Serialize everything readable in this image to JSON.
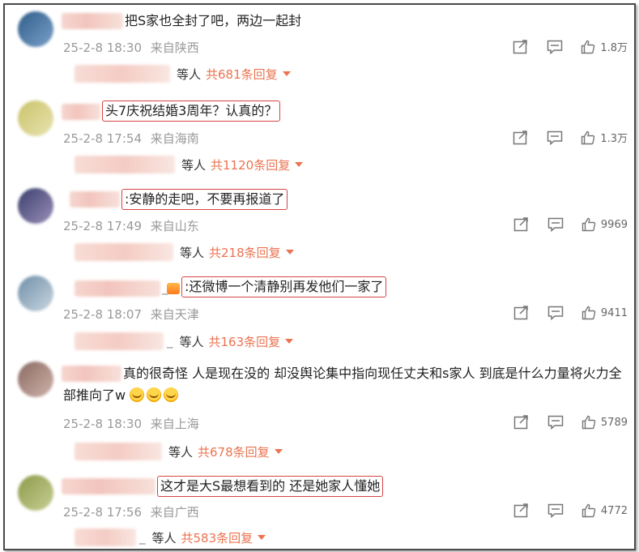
{
  "comments": [
    {
      "text": "把S家也全封了吧，两边一起封",
      "boxed": false,
      "date": "25-2-8 18:30",
      "location": "来自陕西",
      "likes": "1.8万",
      "reply_label": "等人",
      "reply_count": "共681条回复",
      "avatar_colors": [
        "#2f5d8a",
        "#7aa0c8"
      ]
    },
    {
      "text": "头7庆祝结婚3周年？认真的？",
      "boxed": true,
      "date": "25-2-8 17:54",
      "location": "来自海南",
      "likes": "1.3万",
      "reply_label": "等人",
      "reply_count": "共1120条回复",
      "avatar_colors": [
        "#c9c36a",
        "#e8e3b0"
      ]
    },
    {
      "text": ":安静的走吧，不要再报道了",
      "boxed": true,
      "date": "25-2-8 17:49",
      "location": "来自山东",
      "likes": "9969",
      "reply_label": "等人",
      "reply_count": "共218条回复",
      "avatar_colors": [
        "#3a3f6e",
        "#9a8fb8"
      ]
    },
    {
      "text": ":还微博一个清静别再发他们一家了",
      "boxed": true,
      "date": "25-2-8 18:07",
      "location": "来自天津",
      "likes": "9411",
      "reply_label": "等人",
      "reply_count": "共163条回复",
      "avatar_colors": [
        "#6f8fa8",
        "#c9d6e0"
      ]
    },
    {
      "text": "真的很奇怪 人是现在没的 却没舆论集中指向现任丈夫和s家人 到底是什么力量将火力全部推向了w",
      "boxed": false,
      "date": "25-2-8 18:30",
      "location": "来自上海",
      "likes": "5789",
      "reply_label": "等人",
      "reply_count": "共678条回复",
      "avatar_colors": [
        "#8a6a62",
        "#cfb3aa"
      ]
    },
    {
      "text": "这才是大S最想看到的 还是她家人懂她",
      "boxed": true,
      "date": "25-2-8 17:56",
      "location": "来自广西",
      "likes": "4772",
      "reply_label": "等人",
      "reply_count": "共583条回复",
      "avatar_colors": [
        "#8d9a4a",
        "#c8cf94"
      ]
    }
  ],
  "colors": {
    "accent": "#eb7350",
    "highlight_border": "#d64545",
    "meta": "#999999"
  },
  "icons": {
    "share": "share-icon",
    "comment": "comment-icon",
    "like": "thumbs-up-icon",
    "reply_caret": "caret-down-icon"
  }
}
